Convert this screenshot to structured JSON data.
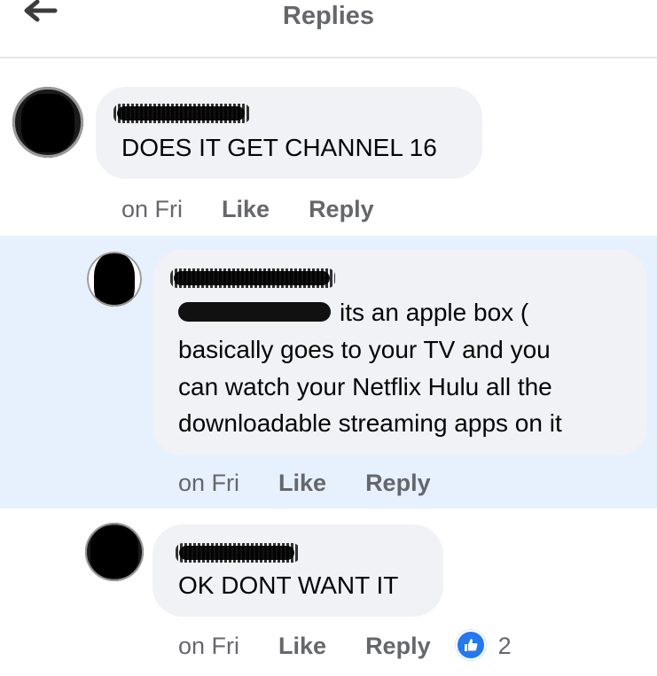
{
  "header": {
    "title": "Replies",
    "back_icon": "arrow-left-icon"
  },
  "comments": [
    {
      "text": "DOES IT GET CHANNEL 16",
      "time": "on Fri",
      "like_label": "Like",
      "reply_label": "Reply"
    },
    {
      "text_line1": "its an apple box (",
      "text_line2": "basically goes to your TV and you",
      "text_line3": "can watch your Netflix Hulu all the",
      "text_line4": "downloadable streaming apps on it",
      "time": "on Fri",
      "like_label": "Like",
      "reply_label": "Reply",
      "highlighted": true
    },
    {
      "text": "OK DONT WANT IT",
      "time": "on Fri",
      "like_label": "Like",
      "reply_label": "Reply",
      "reaction_icon": "like-thumb-icon",
      "reaction_count": "2"
    }
  ],
  "colors": {
    "highlight": "#e7f0fd",
    "bubble": "#f0f2f5",
    "meta_text": "#65676b",
    "like_blue": "#2078f4"
  }
}
